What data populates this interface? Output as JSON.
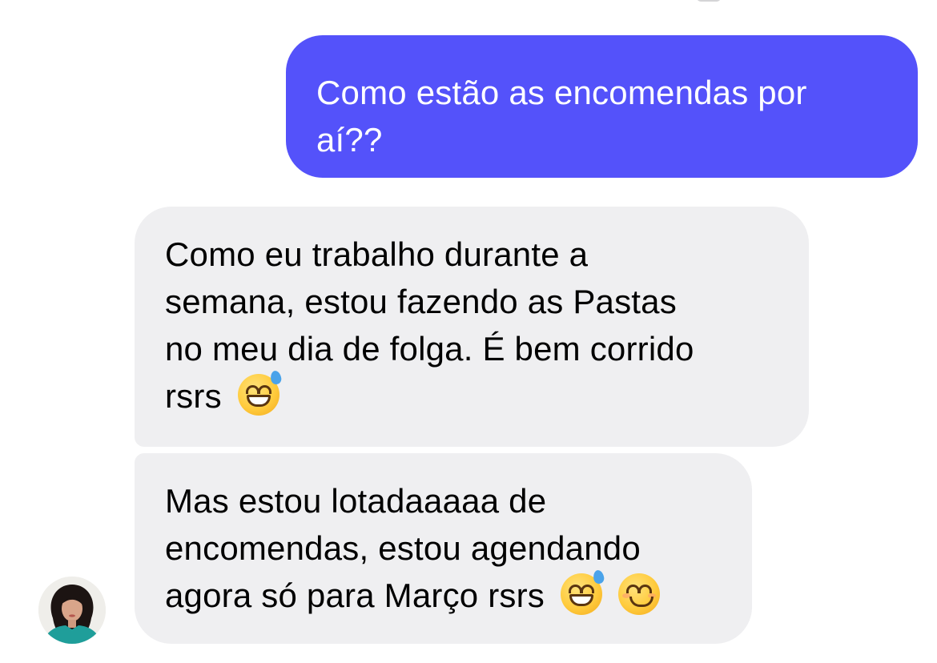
{
  "conversation": {
    "messages": [
      {
        "direction": "outgoing",
        "lines": [
          "Como estão as encomendas por",
          "aí??"
        ]
      },
      {
        "direction": "incoming",
        "lines": [
          "Como eu trabalho durante a",
          "semana, estou fazendo as Pastas",
          "no meu dia de folga. É bem corrido",
          "rsrs"
        ],
        "emojis": [
          "grinning-face-with-sweat"
        ]
      },
      {
        "direction": "incoming",
        "lines": [
          "Mas estou lotadaaaaa de",
          "encomendas, estou agendando",
          "agora só para Março rsrs"
        ],
        "emojis": [
          "grinning-face-with-sweat",
          "smiling-face-with-smiling-eyes"
        ]
      }
    ]
  },
  "colors": {
    "outgoing_bubble": "#5452fa",
    "incoming_bubble": "#efeff1",
    "outgoing_text": "#ffffff",
    "incoming_text": "#000000"
  },
  "icons": {
    "avatar": "contact-avatar"
  }
}
